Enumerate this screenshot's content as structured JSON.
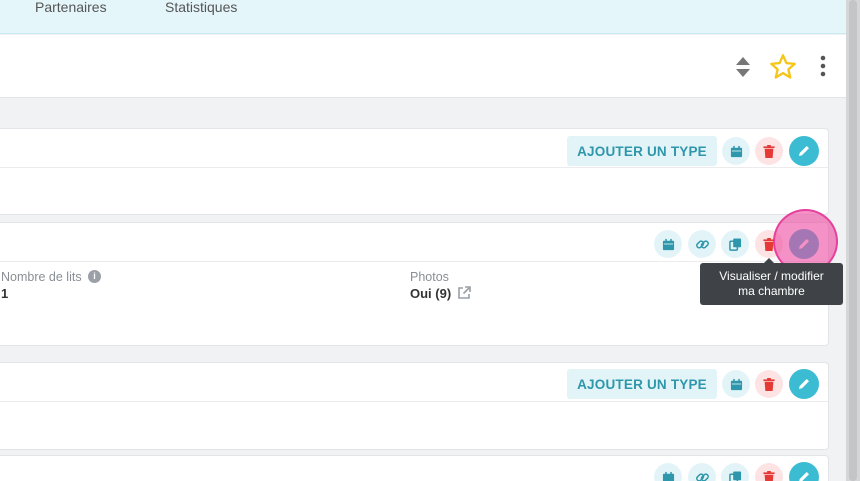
{
  "nav": {
    "items": [
      "Partenaires",
      "Statistiques"
    ]
  },
  "toolbar": {
    "icons": [
      "sort-icon",
      "star-icon",
      "more-vertical-icon"
    ]
  },
  "cards": {
    "add_type_label": "AJOUTER UN TYPE",
    "detail": {
      "beds_label": "Nombre de lits",
      "beds_value": "1",
      "photos_label": "Photos",
      "photos_value": "Oui (9)"
    }
  },
  "tooltip": {
    "text_line1": "Visualiser / modifier",
    "text_line2": "ma chambre"
  },
  "colors": {
    "accent": "#3bbcd2",
    "accent_light": "#e3f4f8",
    "accent_text": "#2e97ab",
    "danger": "#e53935",
    "danger_light": "#fde3e3",
    "star": "#f5c518",
    "highlight": "#ec48a0"
  }
}
